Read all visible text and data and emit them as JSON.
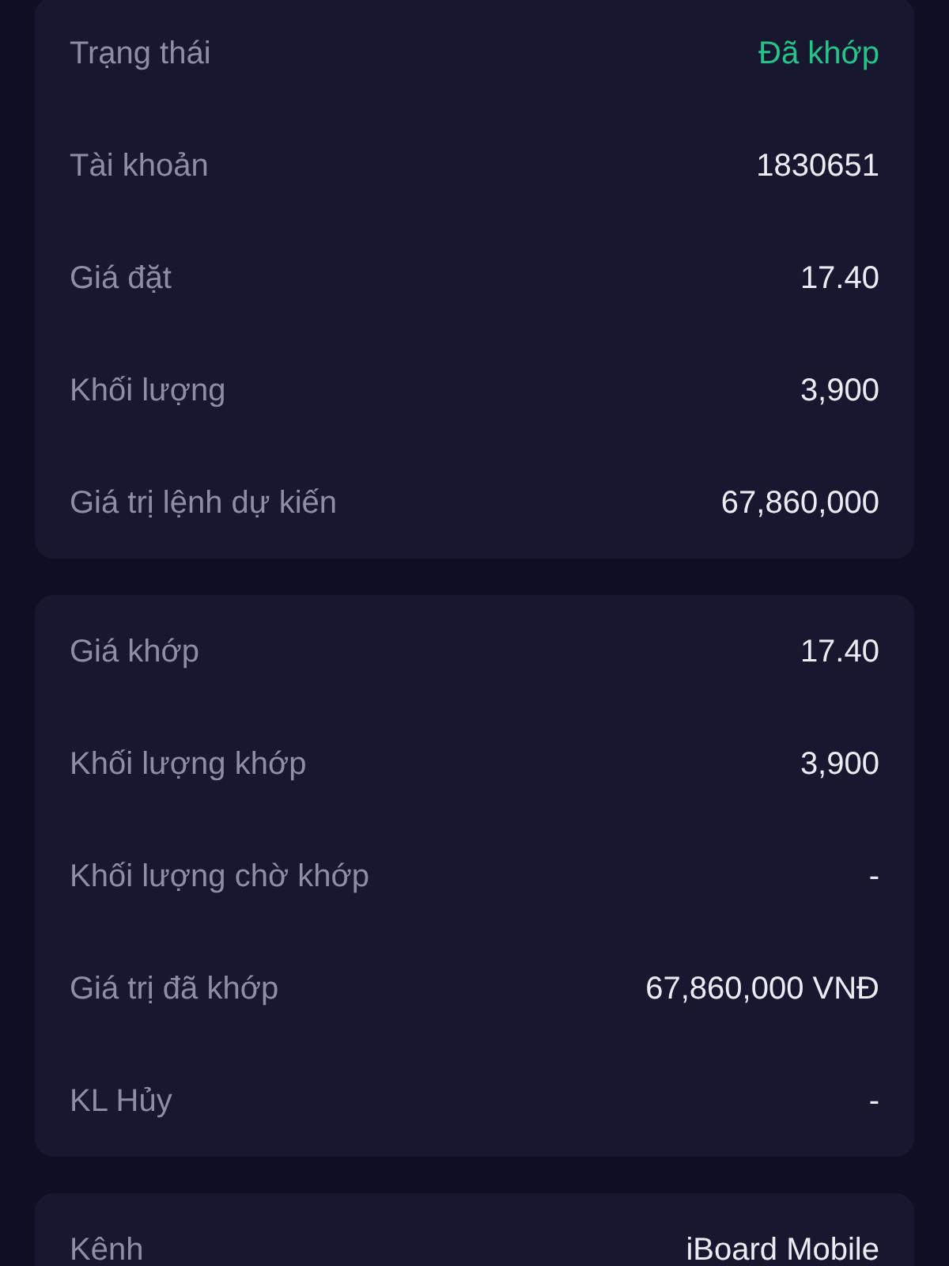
{
  "sections": [
    {
      "rows": [
        {
          "label": "Trạng thái",
          "value": "Đã khớp",
          "kind": "status"
        },
        {
          "label": "Tài khoản",
          "value": "1830651",
          "kind": "plain"
        },
        {
          "label": "Giá đặt",
          "value": "17.40",
          "kind": "plain"
        },
        {
          "label": "Khối lượng",
          "value": "3,900",
          "kind": "plain"
        },
        {
          "label": "Giá trị lệnh dự kiến",
          "value": "67,860,000",
          "kind": "plain"
        }
      ]
    },
    {
      "rows": [
        {
          "label": "Giá khớp",
          "value": "17.40",
          "kind": "plain"
        },
        {
          "label": "Khối lượng khớp",
          "value": "3,900",
          "kind": "plain"
        },
        {
          "label": "Khối lượng chờ khớp",
          "value": "-",
          "kind": "plain"
        },
        {
          "label": "Giá trị đã khớp",
          "value": "67,860,000 VNĐ",
          "kind": "plain"
        },
        {
          "label": "KL Hủy",
          "value": "-",
          "kind": "plain"
        }
      ]
    },
    {
      "rows": [
        {
          "label": "Kênh",
          "value": "iBoard Mobile",
          "kind": "plain"
        }
      ]
    }
  ]
}
